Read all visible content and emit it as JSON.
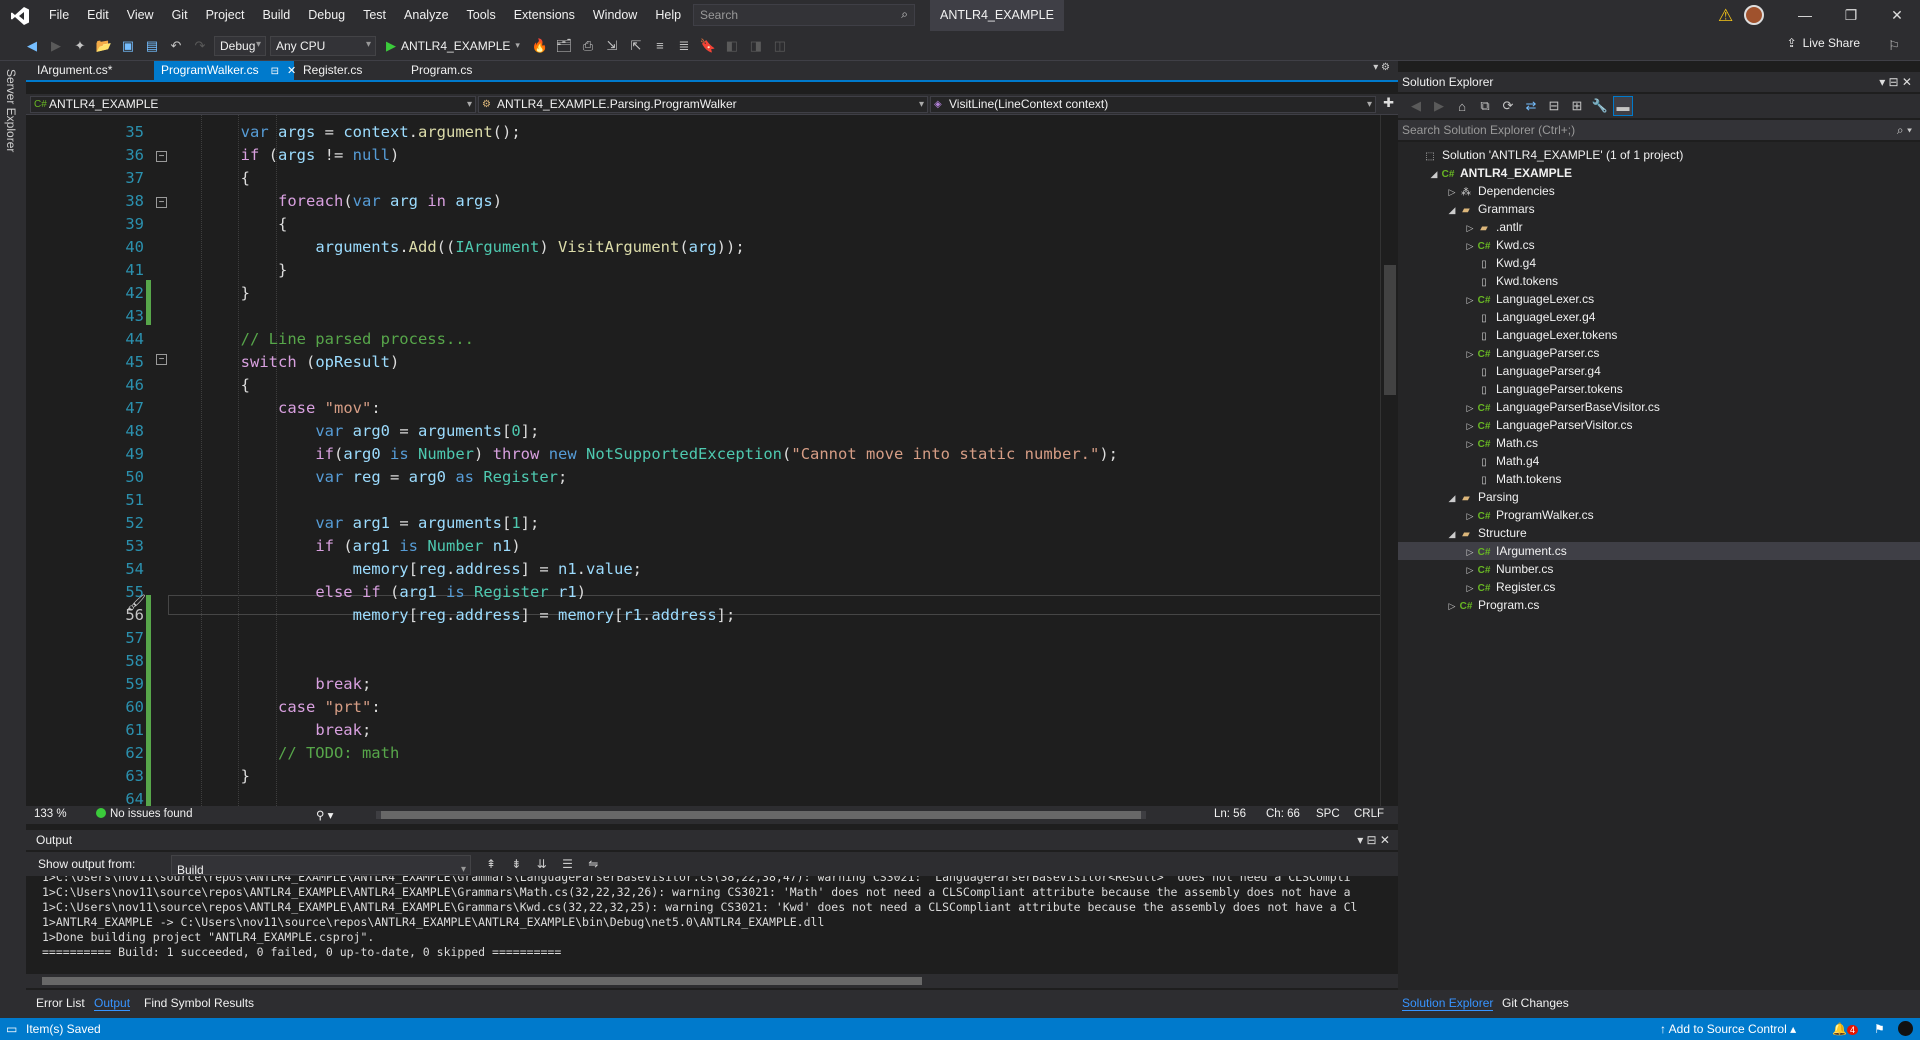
{
  "menu": [
    "File",
    "Edit",
    "View",
    "Git",
    "Project",
    "Build",
    "Debug",
    "Test",
    "Analyze",
    "Tools",
    "Extensions",
    "Window",
    "Help"
  ],
  "search": {
    "placeholder": "Search"
  },
  "solution_title": "ANTLR4_EXAMPLE",
  "toolbar": {
    "config": "Debug",
    "platform": "Any CPU",
    "start_label": "ANTLR4_EXAMPLE",
    "live_share": "Live Share"
  },
  "left_strip": "Server Explorer",
  "tabs": [
    {
      "label": "IArgument.cs*",
      "active": false
    },
    {
      "label": "ProgramWalker.cs",
      "active": true
    },
    {
      "label": "Register.cs",
      "active": false
    },
    {
      "label": "Program.cs",
      "active": false
    }
  ],
  "navbar": {
    "project": "ANTLR4_EXAMPLE",
    "type": "ANTLR4_EXAMPLE.Parsing.ProgramWalker",
    "member": "VisitLine(LineContext context)"
  },
  "editor": {
    "line_numbers": [
      "35",
      "36",
      "37",
      "38",
      "39",
      "40",
      "41",
      "42",
      "43",
      "44",
      "45",
      "46",
      "47",
      "48",
      "49",
      "50",
      "51",
      "52",
      "53",
      "54",
      "55",
      "56",
      "57",
      "58",
      "59",
      "60",
      "61",
      "62",
      "63",
      "64"
    ]
  },
  "editor_status": {
    "zoom": "133 %",
    "issues": "No issues found",
    "ln": "Ln: 56",
    "ch": "Ch: 66",
    "spc": "SPC",
    "eol": "CRLF"
  },
  "output": {
    "title": "Output",
    "show_from_label": "Show output from:",
    "source": "Build",
    "lines": [
      "1>C:\\Users\\nov11\\source\\repos\\ANTLR4_EXAMPLE\\ANTLR4_EXAMPLE\\Grammars\\LanguageParserBaseVisitor.cs(38,22,38,47): warning CS3021: 'LanguageParserBaseVisitor<Result>' does not need a CLSCompli",
      "1>C:\\Users\\nov11\\source\\repos\\ANTLR4_EXAMPLE\\ANTLR4_EXAMPLE\\Grammars\\Math.cs(32,22,32,26): warning CS3021: 'Math' does not need a CLSCompliant attribute because the assembly does not have a",
      "1>C:\\Users\\nov11\\source\\repos\\ANTLR4_EXAMPLE\\ANTLR4_EXAMPLE\\Grammars\\Kwd.cs(32,22,32,25): warning CS3021: 'Kwd' does not need a CLSCompliant attribute because the assembly does not have a Cl",
      "1>ANTLR4_EXAMPLE -> C:\\Users\\nov11\\source\\repos\\ANTLR4_EXAMPLE\\ANTLR4_EXAMPLE\\bin\\Debug\\net5.0\\ANTLR4_EXAMPLE.dll",
      "1>Done building project \"ANTLR4_EXAMPLE.csproj\".",
      "========== Build: 1 succeeded, 0 failed, 0 up-to-date, 0 skipped =========="
    ]
  },
  "bottom_tabs": [
    "Error List",
    "Output",
    "Find Symbol Results"
  ],
  "solution_explorer": {
    "title": "Solution Explorer",
    "search_placeholder": "Search Solution Explorer (Ctrl+;)",
    "nodes": [
      {
        "label": "Solution 'ANTLR4_EXAMPLE' (1 of 1 project)",
        "depth": 0,
        "exp": "",
        "icon": "solution"
      },
      {
        "label": "ANTLR4_EXAMPLE",
        "depth": 1,
        "exp": "◢",
        "icon": "project"
      },
      {
        "label": "Dependencies",
        "depth": 2,
        "exp": "▷",
        "icon": "deps"
      },
      {
        "label": "Grammars",
        "depth": 2,
        "exp": "◢",
        "icon": "folder"
      },
      {
        "label": ".antlr",
        "depth": 3,
        "exp": "▷",
        "icon": "folder"
      },
      {
        "label": "Kwd.cs",
        "depth": 3,
        "exp": "▷",
        "icon": "cs"
      },
      {
        "label": "Kwd.g4",
        "depth": 3,
        "exp": "",
        "icon": "file"
      },
      {
        "label": "Kwd.tokens",
        "depth": 3,
        "exp": "",
        "icon": "file"
      },
      {
        "label": "LanguageLexer.cs",
        "depth": 3,
        "exp": "▷",
        "icon": "cs"
      },
      {
        "label": "LanguageLexer.g4",
        "depth": 3,
        "exp": "",
        "icon": "file"
      },
      {
        "label": "LanguageLexer.tokens",
        "depth": 3,
        "exp": "",
        "icon": "file"
      },
      {
        "label": "LanguageParser.cs",
        "depth": 3,
        "exp": "▷",
        "icon": "cs"
      },
      {
        "label": "LanguageParser.g4",
        "depth": 3,
        "exp": "",
        "icon": "file"
      },
      {
        "label": "LanguageParser.tokens",
        "depth": 3,
        "exp": "",
        "icon": "file"
      },
      {
        "label": "LanguageParserBaseVisitor.cs",
        "depth": 3,
        "exp": "▷",
        "icon": "cs"
      },
      {
        "label": "LanguageParserVisitor.cs",
        "depth": 3,
        "exp": "▷",
        "icon": "cs"
      },
      {
        "label": "Math.cs",
        "depth": 3,
        "exp": "▷",
        "icon": "cs"
      },
      {
        "label": "Math.g4",
        "depth": 3,
        "exp": "",
        "icon": "file"
      },
      {
        "label": "Math.tokens",
        "depth": 3,
        "exp": "",
        "icon": "file"
      },
      {
        "label": "Parsing",
        "depth": 2,
        "exp": "◢",
        "icon": "folder"
      },
      {
        "label": "ProgramWalker.cs",
        "depth": 3,
        "exp": "▷",
        "icon": "cs"
      },
      {
        "label": "Structure",
        "depth": 2,
        "exp": "◢",
        "icon": "folder"
      },
      {
        "label": "IArgument.cs",
        "depth": 3,
        "exp": "▷",
        "icon": "cs",
        "selected": true
      },
      {
        "label": "Number.cs",
        "depth": 3,
        "exp": "▷",
        "icon": "cs"
      },
      {
        "label": "Register.cs",
        "depth": 3,
        "exp": "▷",
        "icon": "cs"
      },
      {
        "label": "Program.cs",
        "depth": 2,
        "exp": "▷",
        "icon": "cs"
      }
    ]
  },
  "se_bottom_tabs": [
    "Solution Explorer",
    "Git Changes"
  ],
  "statusbar": {
    "left": "Item(s) Saved",
    "source_control": "Add to Source Control",
    "notifications": "4"
  }
}
